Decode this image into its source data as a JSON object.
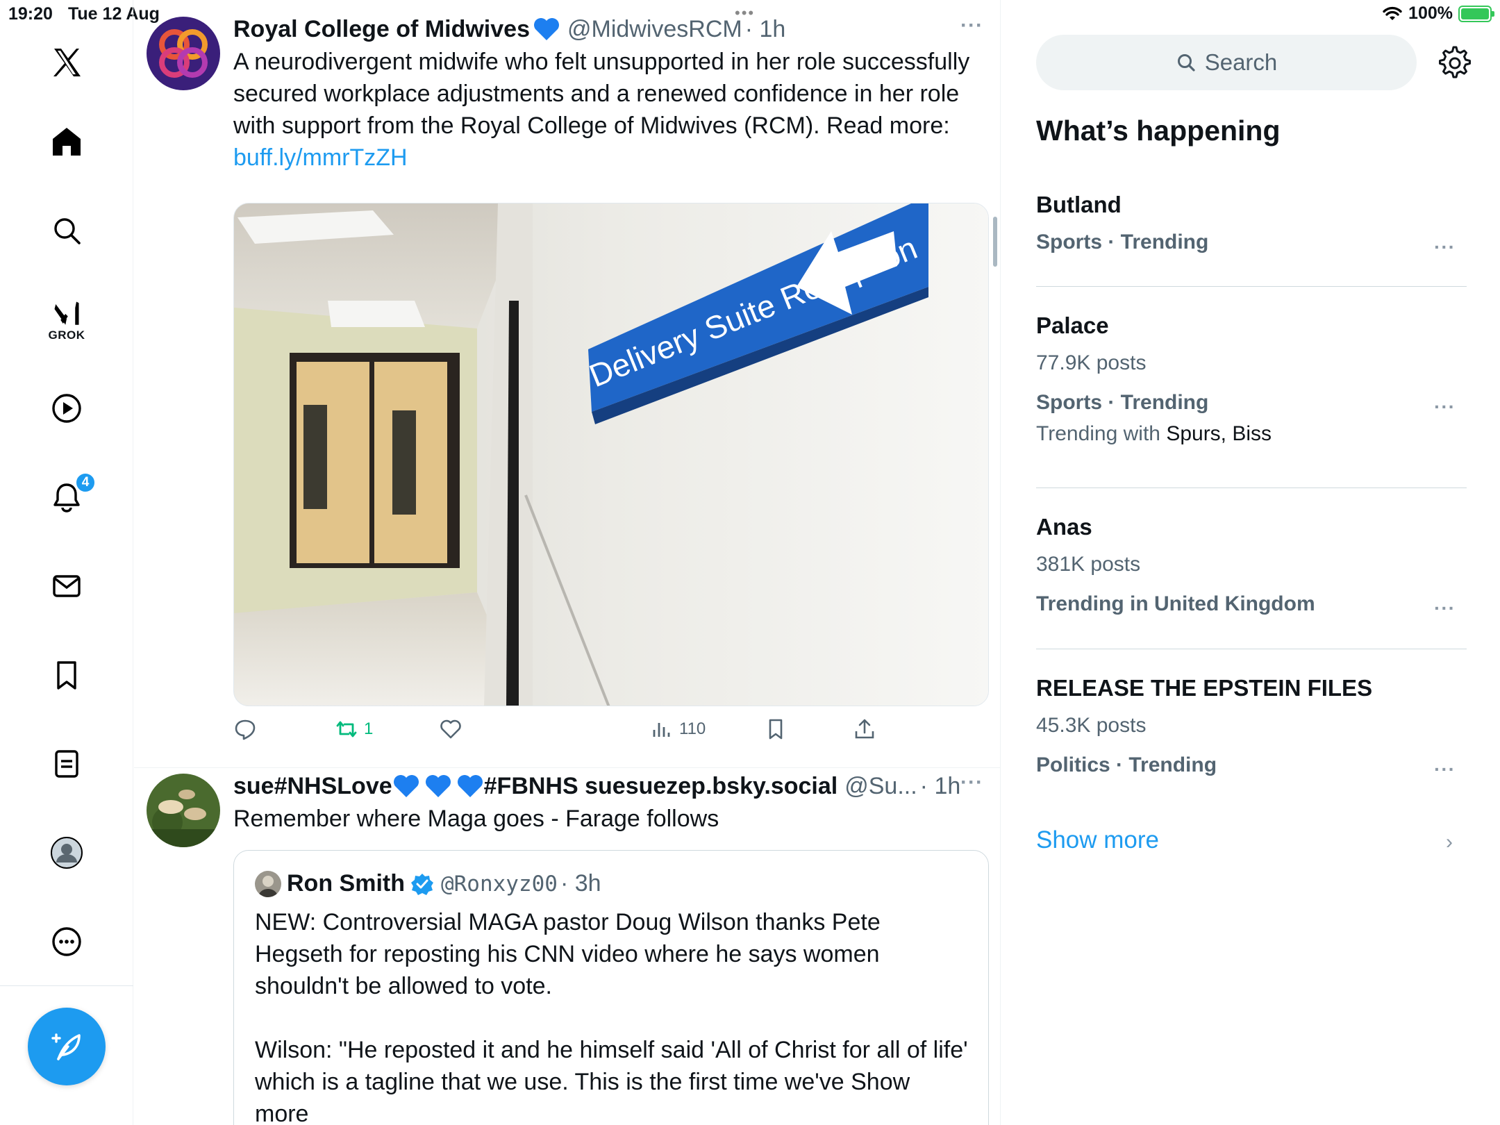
{
  "status_bar": {
    "time": "19:20",
    "date": "Tue 12 Aug",
    "battery": "100%",
    "multitask_dots": "•••"
  },
  "nav": {
    "grok_label": "GROK",
    "notification_count": "4",
    "icons": [
      "x-logo-icon",
      "home-icon",
      "search-icon",
      "grok-icon",
      "video-icon",
      "bell-icon",
      "mail-icon",
      "bookmark-icon",
      "lists-icon",
      "profile-icon",
      "more-icon",
      "compose-icon"
    ]
  },
  "feed": {
    "tweets": [
      {
        "name": "Royal College of Midwives",
        "handle": "@MidwivesRCM",
        "time": "· 1h",
        "text": "A neurodivergent midwife who felt unsupported in her role successfully secured workplace adjustments and a renewed confidence in her role with support from the Royal College of Midwives (RCM). Read more:",
        "link": "buff.ly/mmrTzZH",
        "image_sign_text": "Delivery Suite Reception",
        "retweets": "1",
        "views": "110"
      },
      {
        "name_part1": "sue#NHSLove",
        "name_part2": "#FBNHS suesuezep.bsky.social",
        "handle": "@Su...",
        "time": "· 1h",
        "text": "Remember where Maga goes - Farage follows",
        "quote": {
          "name": "Ron Smith",
          "handle": "@Ronxyz00",
          "time": "· 3h",
          "paragraph1": "NEW: Controversial MAGA pastor Doug Wilson thanks Pete Hegseth for reposting his CNN video where he says women shouldn't be allowed to vote.",
          "paragraph2": "Wilson: \"He reposted it and he himself said 'All of Christ for all of life' which is a tagline that we use. This is the first time we've",
          "show_more": "Show more"
        }
      }
    ]
  },
  "sidebar": {
    "search_placeholder": "Search",
    "title": "What’s happening",
    "trends": [
      {
        "name": "Butland",
        "category": "Sports · Trending"
      },
      {
        "name": "Palace",
        "posts": "77.9K posts",
        "category": "Sports · Trending",
        "context_prefix": "Trending with ",
        "context_names": "Spurs, Biss"
      },
      {
        "name": "Anas",
        "posts": "381K posts",
        "category": "Trending in United Kingdom"
      },
      {
        "name": "RELEASE THE EPSTEIN FILES",
        "posts": "45.3K posts",
        "category": "Politics · Trending"
      }
    ],
    "show_more": "Show more"
  },
  "colors": {
    "accent": "#1d9bf0",
    "retweet_green": "#00ba7c",
    "secondary_text": "#536471"
  }
}
